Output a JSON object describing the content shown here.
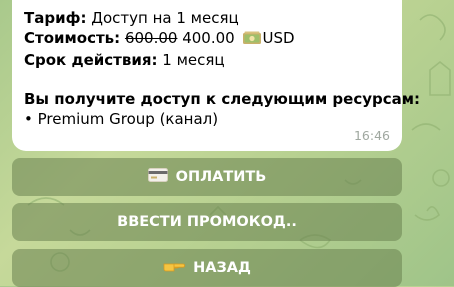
{
  "message": {
    "tariff_label": "Тариф:",
    "tariff_value": "Доступ на 1 месяц",
    "cost_label": "Стоимость:",
    "cost_old": "600.00",
    "cost_new": "400.00",
    "cost_currency": "USD",
    "period_label": "Срок действия:",
    "period_value": "1 месяц",
    "access_heading": "Вы получите доступ к следующим ресурсам:",
    "resources": [
      "• Premium Group (канал)"
    ],
    "time": "16:46"
  },
  "keyboard": {
    "pay_label": "ОПЛАТИТЬ",
    "promo_label": "ВВЕСТИ ПРОМОКОД..",
    "back_label": "НАЗАД"
  },
  "icons": {
    "money": "money-icon",
    "card": "credit-card-icon",
    "back": "pointing-hand-icon"
  }
}
